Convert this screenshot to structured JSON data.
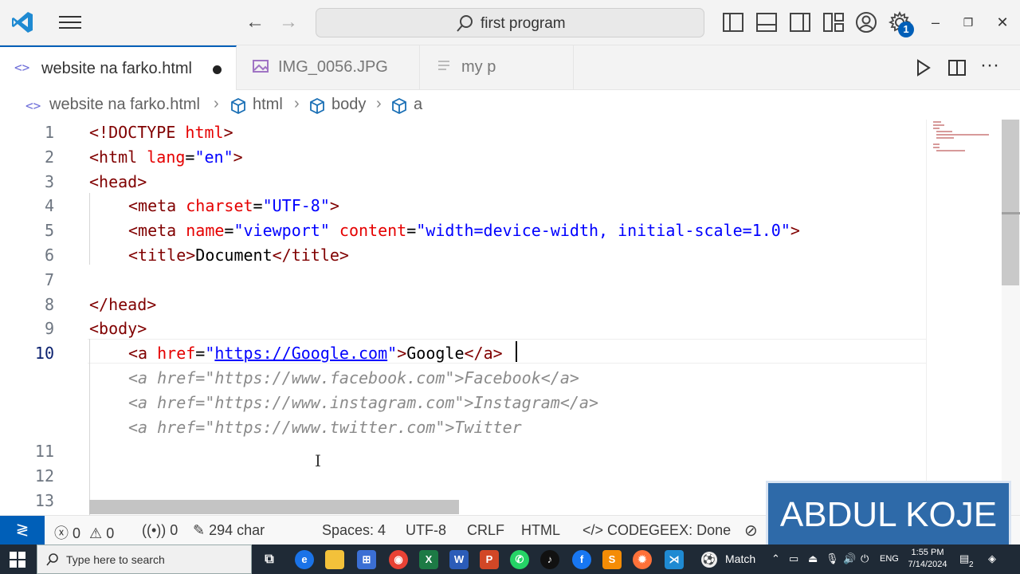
{
  "titlebar": {
    "search_text": "first program",
    "settings_badge": "1"
  },
  "tabs": [
    {
      "label": "website na farko.html",
      "icon": "html-file-icon",
      "modified": true
    },
    {
      "label": "IMG_0056.JPG",
      "icon": "image-file-icon"
    },
    {
      "label": "my p",
      "icon": "text-file-icon"
    }
  ],
  "breadcrumb": {
    "file": "website na farko.html",
    "items": [
      "html",
      "body",
      "a"
    ]
  },
  "editor": {
    "line_numbers": [
      "1",
      "2",
      "3",
      "4",
      "5",
      "6",
      "7",
      "8",
      "9",
      "10",
      "11",
      "12",
      "13"
    ],
    "lines": {
      "l1_a": "<!DOCTYPE ",
      "l1_b": "html",
      "l1_c": ">",
      "l2_a": "<html ",
      "l2_b": "lang",
      "l2_c": "=",
      "l2_d": "\"en\"",
      "l2_e": ">",
      "l3": "<head>",
      "l4_a": "<meta ",
      "l4_b": "charset",
      "l4_c": "=",
      "l4_d": "\"UTF-8\"",
      "l4_e": ">",
      "l5_a": "<meta ",
      "l5_b": "name",
      "l5_c": "=",
      "l5_d": "\"viewport\"",
      "l5_e": " content",
      "l5_f": "=",
      "l5_g": "\"width=device-width, initial-scale=1.0\"",
      "l5_h": ">",
      "l6_a": "<title>",
      "l6_b": "Document",
      "l6_c": "</title>",
      "l8": "</head>",
      "l9": "<body>",
      "l10_a": "<a ",
      "l10_b": "href",
      "l10_c": "=",
      "l10_d": "\"",
      "l10_e": "https://Google.com",
      "l10_f": "\"",
      "l10_g": ">",
      "l10_h": "Google",
      "l10_i": "</a>"
    },
    "suggestions": [
      "<a href=\"https://www.facebook.com\">Facebook</a>",
      "<a href=\"https://www.instagram.com\">Instagram</a>",
      "<a href=\"https://www.twitter.com\">Twitter"
    ]
  },
  "statusbar": {
    "errors": "0",
    "warnings": "0",
    "ports": "0",
    "chars": "294 char",
    "spaces": "Spaces: 4",
    "encoding": "UTF-8",
    "eol": "CRLF",
    "language": "HTML",
    "codegeex": "CODEGEEX: Done"
  },
  "watermark": "ABDUL KOJE",
  "taskbar": {
    "search_placeholder": "Type here to search",
    "match_label": "Match",
    "lang": "ENG",
    "time": "1:55 PM",
    "date": "7/14/2024",
    "notification_count": "2"
  },
  "colors": {
    "accent": "#005fb8",
    "tag": "#800000",
    "attribute": "#e50000",
    "string": "#0000ff"
  }
}
